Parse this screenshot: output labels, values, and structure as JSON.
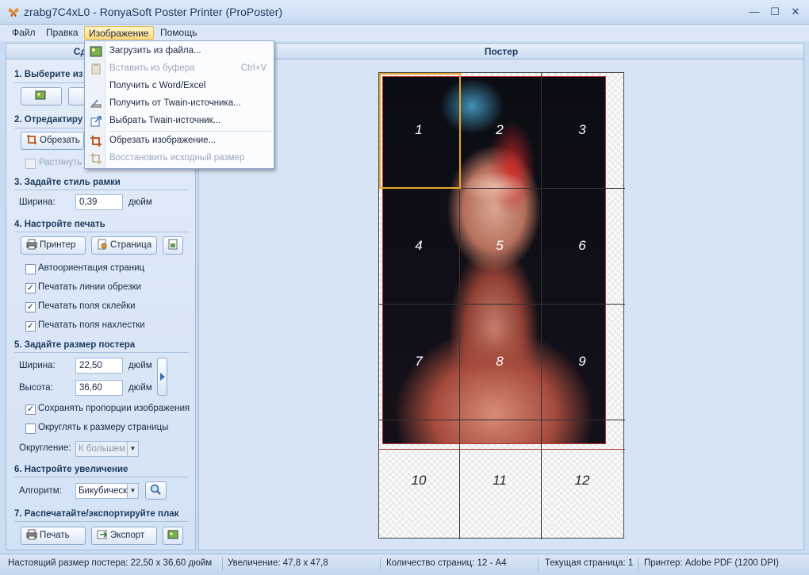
{
  "window": {
    "title": "zrabg7C4xL0 - RonyaSoft Poster Printer (ProPoster)",
    "minimize": "—",
    "maximize": "☐",
    "close": "✕"
  },
  "menubar": [
    "Файл",
    "Правка",
    "Изображение",
    "Помощь"
  ],
  "image_menu": {
    "items": [
      {
        "label": "Загрузить из файла...",
        "icon": "load-image-icon",
        "enabled": true
      },
      {
        "label": "Вставить из буфера",
        "shortcut": "Ctrl+V",
        "icon": "paste-icon",
        "enabled": false
      },
      {
        "label": "Получить с Word/Excel",
        "icon": "",
        "enabled": true
      },
      {
        "label": "Получить от Twain-источника...",
        "icon": "scanner-icon",
        "enabled": true
      },
      {
        "label": "Выбрать Twain-источник...",
        "icon": "select-source-icon",
        "enabled": true
      },
      {
        "label": "Обрезать изображение...",
        "icon": "crop-icon",
        "enabled": true
      },
      {
        "label": "Восстановить исходный размер",
        "icon": "restore-icon",
        "enabled": false
      }
    ]
  },
  "left_panel": {
    "header": "Сделай кла",
    "section1": "1. Выберите из",
    "section2": "2. Отредактиру",
    "crop_button": "Обрезать",
    "stretch_label": "Растянуть и",
    "section3": "3. Задайте стиль рамки",
    "frame_width_label": "Ширина:",
    "frame_width_value": "0,39",
    "unit": "дюйм",
    "section4": "4. Настройте печать",
    "printer_button": "Принтер",
    "page_button": "Страница",
    "auto_orient": "Автоориентация страниц",
    "print_cut_lines": "Печатать линии обрезки",
    "print_glue_margins": "Печатать поля склейки",
    "print_overlap_margins": "Печатать поля нахлестки",
    "section5": "5. Задайте размер постера",
    "width_label": "Ширина:",
    "width_value": "22,50",
    "height_label": "Высота:",
    "height_value": "36,60",
    "keep_proportions": "Сохранять пропорции изображения",
    "round_to_page": "Округлять к размеру страницы",
    "rounding_label": "Округление:",
    "rounding_value": "К большем",
    "section6": "6. Настройте увеличение",
    "algorithm_label": "Алгоритм:",
    "algorithm_value": "Бикубическ",
    "section7": "7. Распечатайте/экспортируйте плак",
    "print_button": "Печать",
    "export_button": "Экспорт"
  },
  "checkboxes": {
    "stretch": false,
    "auto_orient": false,
    "print_cut_lines": true,
    "print_glue_margins": true,
    "print_overlap_margins": true,
    "keep_proportions": true,
    "round_to_page": false
  },
  "right_panel": {
    "header": "Постер",
    "tiles": [
      "1",
      "2",
      "3",
      "4",
      "5",
      "6",
      "7",
      "8",
      "9",
      "10",
      "11",
      "12"
    ]
  },
  "status": {
    "real_size": "Настоящий размер постера: 22,50 x 36,60 дюйм",
    "zoom": "Увеличение: 47,8 x 47,8",
    "page_count": "Количество страниц: 12 - A4",
    "current_page": "Текущая страница: 1",
    "printer": "Принтер: Adobe PDF (1200 DPI)"
  },
  "colors": {
    "accent": "#e9a530",
    "frame": "#c9dcf2"
  }
}
